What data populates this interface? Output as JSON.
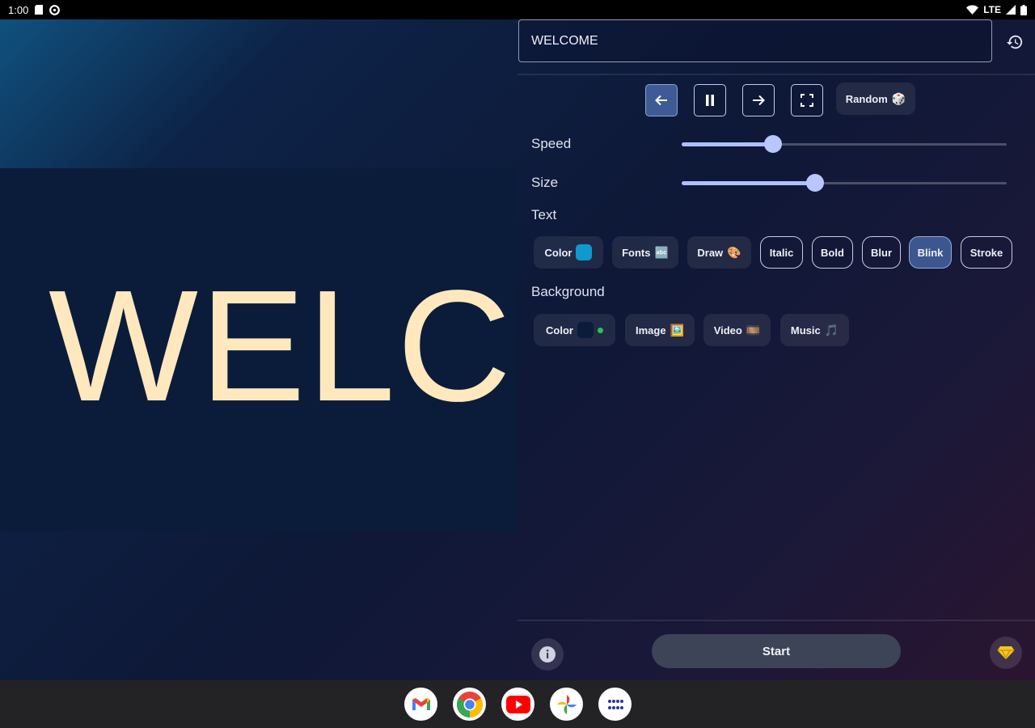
{
  "status_bar": {
    "time": "1:00",
    "network": "LTE"
  },
  "preview": {
    "text": "WELCOME",
    "text_color": "#ffe8bd",
    "band_color": "#0a1c3a"
  },
  "panel": {
    "text_input_value": "WELCOME",
    "controls": {
      "random_label": "Random",
      "random_emoji": "🎲",
      "active_button": "scroll-left"
    },
    "speed": {
      "label": "Speed",
      "value_fraction": 0.28
    },
    "size": {
      "label": "Size",
      "value_fraction": 0.41
    },
    "text_section": {
      "heading": "Text",
      "color_label": "Color",
      "color_swatch": "#0f9acd",
      "fonts_label": "Fonts",
      "fonts_emoji": "🔤",
      "draw_label": "Draw",
      "draw_emoji": "🎨",
      "toggles": [
        {
          "label": "Italic",
          "selected": false
        },
        {
          "label": "Bold",
          "selected": false
        },
        {
          "label": "Blur",
          "selected": false
        },
        {
          "label": "Blink",
          "selected": true
        },
        {
          "label": "Stroke",
          "selected": false
        }
      ]
    },
    "background_section": {
      "heading": "Background",
      "color_label": "Color",
      "color_swatch": "#0a1c3a",
      "indicator_color": "#22c94a",
      "image_label": "Image",
      "image_emoji": "🖼️",
      "video_label": "Video",
      "video_emoji": "🎞️",
      "music_label": "Music",
      "music_emoji": "🎵"
    },
    "start_label": "Start"
  },
  "taskbar": {
    "apps": [
      "gmail-icon",
      "chrome-icon",
      "youtube-icon",
      "photos-icon",
      "app-launcher-icon"
    ]
  }
}
